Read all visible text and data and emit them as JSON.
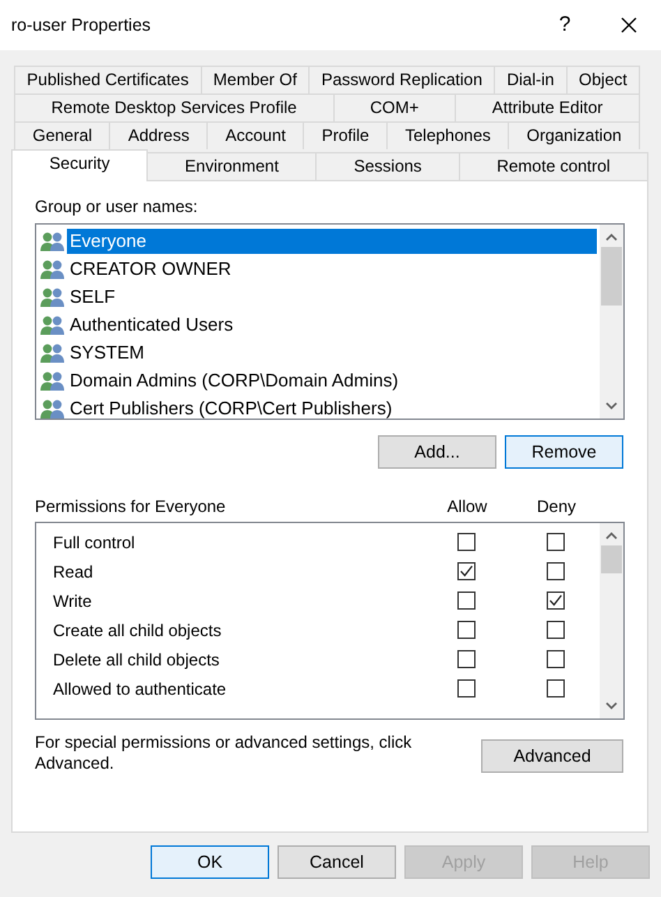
{
  "window": {
    "title": "ro-user Properties",
    "help": "?"
  },
  "tab_rows": [
    [
      {
        "label": "Published Certificates",
        "selected": false
      },
      {
        "label": "Member Of",
        "selected": false
      },
      {
        "label": "Password Replication",
        "selected": false
      },
      {
        "label": "Dial-in",
        "selected": false
      },
      {
        "label": "Object",
        "selected": false
      }
    ],
    [
      {
        "label": "Remote Desktop Services Profile",
        "selected": false
      },
      {
        "label": "COM+",
        "selected": false
      },
      {
        "label": "Attribute Editor",
        "selected": false
      }
    ],
    [
      {
        "label": "General",
        "selected": false
      },
      {
        "label": "Address",
        "selected": false
      },
      {
        "label": "Account",
        "selected": false
      },
      {
        "label": "Profile",
        "selected": false
      },
      {
        "label": "Telephones",
        "selected": false
      },
      {
        "label": "Organization",
        "selected": false
      }
    ],
    [
      {
        "label": "Security",
        "selected": true
      },
      {
        "label": "Environment",
        "selected": false
      },
      {
        "label": "Sessions",
        "selected": false
      },
      {
        "label": "Remote control",
        "selected": false
      }
    ]
  ],
  "groups": {
    "label": "Group or user names:",
    "items": [
      {
        "name": "Everyone",
        "selected": true
      },
      {
        "name": "CREATOR OWNER",
        "selected": false
      },
      {
        "name": "SELF",
        "selected": false
      },
      {
        "name": "Authenticated Users",
        "selected": false
      },
      {
        "name": "SYSTEM",
        "selected": false
      },
      {
        "name": "Domain Admins (CORP\\Domain Admins)",
        "selected": false
      },
      {
        "name": "Cert Publishers (CORP\\Cert Publishers)",
        "selected": false
      }
    ],
    "buttons": [
      {
        "label": "Add...",
        "focused": false
      },
      {
        "label": "Remove",
        "focused": true
      }
    ]
  },
  "permissions": {
    "label": "Permissions for Everyone",
    "columns": [
      "Allow",
      "Deny"
    ],
    "rows": [
      {
        "name": "Full control",
        "allow": false,
        "deny": false
      },
      {
        "name": "Read",
        "allow": true,
        "deny": false
      },
      {
        "name": "Write",
        "allow": false,
        "deny": true
      },
      {
        "name": "Create all child objects",
        "allow": false,
        "deny": false
      },
      {
        "name": "Delete all child objects",
        "allow": false,
        "deny": false
      },
      {
        "name": "Allowed to authenticate",
        "allow": false,
        "deny": false
      }
    ]
  },
  "advanced": {
    "note": "For special permissions or advanced settings, click Advanced.",
    "button": "Advanced"
  },
  "footer_buttons": [
    {
      "label": "OK",
      "focused": true,
      "disabled": false
    },
    {
      "label": "Cancel",
      "focused": false,
      "disabled": false
    },
    {
      "label": "Apply",
      "focused": false,
      "disabled": true
    },
    {
      "label": "Help",
      "focused": false,
      "disabled": true
    }
  ]
}
